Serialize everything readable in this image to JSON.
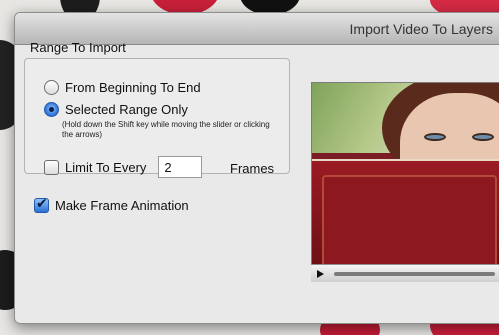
{
  "window": {
    "title": "Import Video To Layers"
  },
  "range": {
    "group_label": "Range To Import",
    "options": [
      {
        "label": "From Beginning To End",
        "selected": false
      },
      {
        "label": "Selected Range Only",
        "selected": true
      }
    ],
    "hint": "(Hold down the Shift key while moving the slider or clicking the arrows)"
  },
  "limit": {
    "label": "Limit To Every",
    "checked": false,
    "value": "2",
    "unit_label": "Frames"
  },
  "animation": {
    "label": "Make Frame Animation",
    "checked": true
  },
  "preview": {
    "play_icon": "play-icon"
  }
}
